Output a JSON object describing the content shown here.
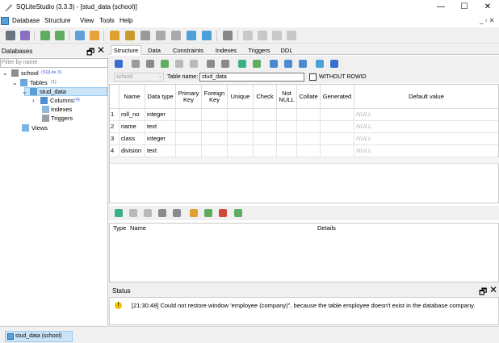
{
  "window": {
    "title": "SQLiteStudio (3.3.3) - [stud_data (school)]",
    "minimize": "—",
    "maximize": "☐",
    "close": "✕"
  },
  "menubar": {
    "items": [
      "Database",
      "Structure",
      "View",
      "Tools",
      "Help"
    ],
    "mdi_controls": "_ ▫ ✕"
  },
  "dbpanel": {
    "title": "Databases",
    "filter_placeholder": "Filter by name",
    "tree": {
      "db_name": "school",
      "db_meta": "(SQLite 3)",
      "tables_label": "Tables",
      "tables_count": "(1)",
      "table_name": "stud_data",
      "columns_label": "Columns",
      "columns_count": "(4)",
      "indexes_label": "Indexes",
      "triggers_label": "Triggers",
      "views_label": "Views"
    }
  },
  "editor": {
    "tabs": [
      "Structure",
      "Data",
      "Constraints",
      "Indexes",
      "Triggers",
      "DDL"
    ],
    "active_tab": "Structure",
    "db_combo": "school",
    "table_name_label": "Table name:",
    "table_name_value": "stud_data",
    "without_rowid": "WITHOUT ROWID",
    "headers": {
      "name": "Name",
      "data_type": "Data type",
      "primary_key": "Primary Key",
      "foreign_key": "Foreign Key",
      "unique": "Unique",
      "check": "Check",
      "not_null": "Not NULL",
      "collate": "Collate",
      "generated": "Generated",
      "default_value": "Default value"
    },
    "rows": [
      {
        "num": "1",
        "name": "roll_no",
        "type": "integer",
        "default": "NULL"
      },
      {
        "num": "2",
        "name": "name",
        "type": "text",
        "default": "NULL"
      },
      {
        "num": "3",
        "name": "class",
        "type": "integer",
        "default": "NULL"
      },
      {
        "num": "4",
        "name": "division",
        "type": "text",
        "default": "NULL"
      }
    ],
    "constraints_headers": {
      "type": "Type",
      "name": "Name",
      "details": "Details"
    }
  },
  "status": {
    "title": "Status",
    "message": "[21:30:48]  Could not restore window 'employee (company)'', because the table employee doesn't exist in the database company."
  },
  "taskbar": {
    "item": "stud_data (school)"
  },
  "colors": {
    "selection": "#cce4f7",
    "accent": "#3a5fd0",
    "null_text": "#b4b4b4",
    "warning": "#f2c200"
  }
}
